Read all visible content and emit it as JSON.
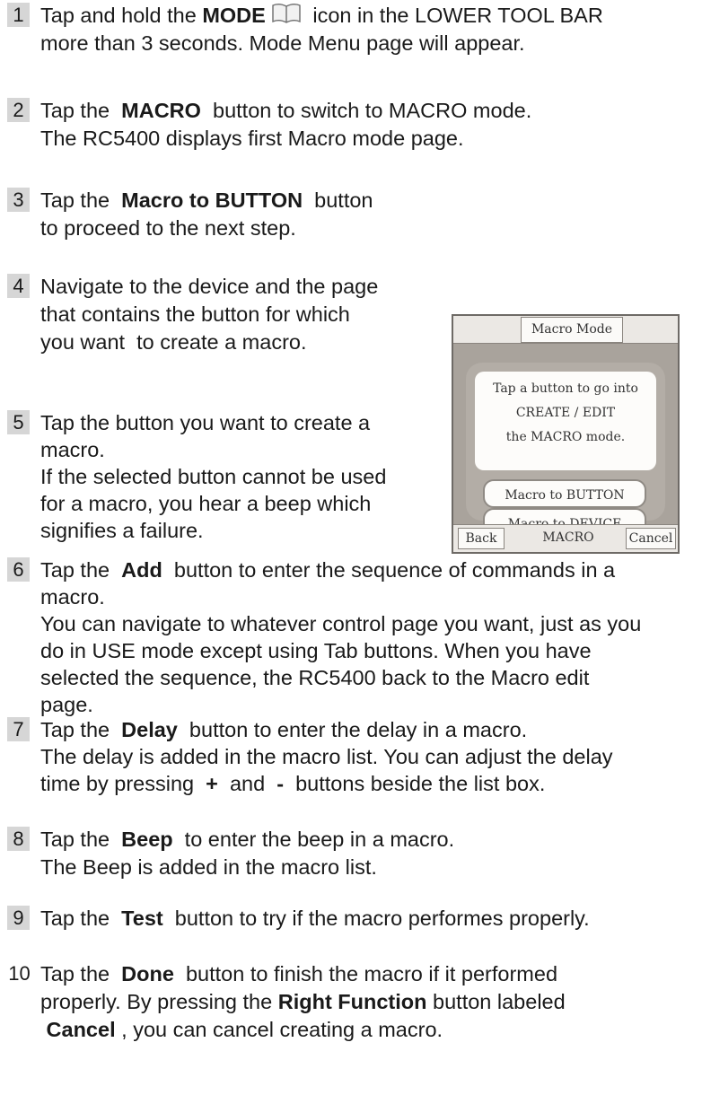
{
  "steps": [
    {
      "num": "1",
      "lines": [
        {
          "parts": [
            {
              "t": "Tap and hold the "
            },
            {
              "b": "MODE"
            },
            {
              "icon": "book-icon"
            },
            {
              "t": " icon in the LOWER TOOL BAR"
            }
          ]
        },
        {
          "parts": [
            {
              "t": "more than 3 seconds. Mode Menu page will appear."
            }
          ]
        }
      ]
    },
    {
      "num": "2",
      "lines": [
        {
          "parts": [
            {
              "t": "Tap the  "
            },
            {
              "b": "MACRO"
            },
            {
              "t": "  button to switch to MACRO mode."
            }
          ]
        },
        {
          "parts": [
            {
              "t": "The RC5400 displays first Macro mode page."
            }
          ]
        }
      ]
    },
    {
      "num": "3",
      "lines": [
        {
          "parts": [
            {
              "t": "Tap the  "
            },
            {
              "b": "Macro to BUTTON"
            },
            {
              "t": "  button"
            }
          ]
        },
        {
          "parts": [
            {
              "t": "to proceed to the next step."
            }
          ]
        }
      ]
    },
    {
      "num": "4",
      "lines": [
        {
          "parts": [
            {
              "t": "Navigate to the device and the page"
            }
          ]
        },
        {
          "parts": [
            {
              "t": "that contains the button for which"
            }
          ]
        },
        {
          "parts": [
            {
              "t": "you want  to create a macro."
            }
          ]
        }
      ]
    },
    {
      "num": "5",
      "lines": [
        {
          "parts": [
            {
              "t": "Tap the button you want to create a"
            }
          ]
        },
        {
          "parts": [
            {
              "t": "macro."
            }
          ]
        },
        {
          "parts": [
            {
              "t": "If the selected button cannot be used"
            }
          ]
        },
        {
          "parts": [
            {
              "t": "for a macro, you hear a beep which"
            }
          ]
        },
        {
          "parts": [
            {
              "t": "signifies a failure."
            }
          ]
        }
      ]
    },
    {
      "num": "6",
      "lines": [
        {
          "parts": [
            {
              "t": "Tap the  "
            },
            {
              "b": "Add"
            },
            {
              "t": "  button to enter the sequence of commands in a"
            }
          ]
        },
        {
          "parts": [
            {
              "t": "macro."
            }
          ]
        },
        {
          "parts": [
            {
              "t": "You can navigate to whatever control page you want, just as you"
            }
          ]
        },
        {
          "parts": [
            {
              "t": "do in USE mode except using Tab buttons. When you have"
            }
          ]
        },
        {
          "parts": [
            {
              "t": "selected the sequence, the RC5400 back to the Macro edit"
            }
          ]
        },
        {
          "parts": [
            {
              "t": "page."
            }
          ]
        }
      ]
    },
    {
      "num": "7",
      "lines": [
        {
          "parts": [
            {
              "t": "Tap the  "
            },
            {
              "b": "Delay"
            },
            {
              "t": "  button to enter the delay in a macro."
            }
          ]
        },
        {
          "parts": [
            {
              "t": "The delay is added in the macro list. You can adjust the delay"
            }
          ]
        },
        {
          "parts": [
            {
              "t": "time by pressing  "
            },
            {
              "b": "+"
            },
            {
              "t": "  and  "
            },
            {
              "b": "-"
            },
            {
              "t": "  buttons beside the list box."
            }
          ]
        }
      ]
    },
    {
      "num": "8",
      "lines": [
        {
          "parts": [
            {
              "t": "Tap the  "
            },
            {
              "b": "Beep"
            },
            {
              "t": "  to enter the beep in a macro."
            }
          ]
        },
        {
          "parts": [
            {
              "t": "The Beep is added in the macro list."
            }
          ]
        }
      ]
    },
    {
      "num": "9",
      "lines": [
        {
          "parts": [
            {
              "t": "Tap the  "
            },
            {
              "b": "Test"
            },
            {
              "t": "  button to try if the macro performes properly."
            }
          ]
        }
      ]
    },
    {
      "num": "10",
      "lines": [
        {
          "parts": [
            {
              "t": "Tap the  "
            },
            {
              "b": "Done"
            },
            {
              "t": "  button to finish the macro if it performed"
            }
          ]
        },
        {
          "parts": [
            {
              "t": "properly. By pressing the "
            },
            {
              "b": "Right Function"
            },
            {
              "t": " button labeled"
            }
          ]
        },
        {
          "parts": [
            {
              "t": " "
            },
            {
              "b": "Cancel"
            },
            {
              "t": " , you can cancel creating a macro."
            }
          ]
        }
      ]
    }
  ],
  "device": {
    "title": "Macro Mode",
    "message": [
      "Tap a button to go into",
      "CREATE / EDIT",
      "the MACRO mode."
    ],
    "buttons": [
      "Macro to BUTTON",
      "Macro to DEVICE"
    ],
    "bottom": {
      "left": "Back",
      "center": "MACRO",
      "right": "Cancel"
    }
  }
}
